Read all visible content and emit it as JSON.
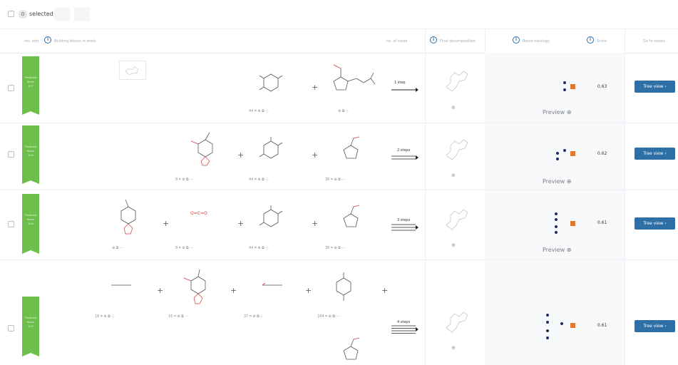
{
  "toolbar": {
    "selected_count": "0",
    "selected_label": "selected"
  },
  "columns": {
    "sort_label": "rec. sort",
    "building_blocks": "Building blocks in stock",
    "reactions": "no. of steps",
    "final_molecule": "Final decomposition",
    "route_topology": "Route topology",
    "score": "Score",
    "actions": "Go to routes"
  },
  "icons": {
    "info": "info-icon",
    "zoom": "magnifier-icon",
    "chevron": "chevron-right-icon"
  },
  "colors": {
    "ribbon": "#6cbf4b",
    "button": "#2e6fa6",
    "node": "#1f2f66",
    "target": "#e07a2e"
  },
  "routes": [
    {
      "ribbon_lines": [
        "Predicted",
        "Route",
        "#17"
      ],
      "steps_label": "1 step",
      "score": "0.63",
      "preview_label": "Preview",
      "tree_label": "Tree view",
      "tools": [
        "44 ⌗ ⊕ ⧉ ···",
        "⊕ ⧉ ···"
      ]
    },
    {
      "ribbon_lines": [
        "Predicted",
        "Route",
        "#18"
      ],
      "steps_label": "2 steps",
      "score": "0.62",
      "preview_label": "Preview",
      "tree_label": "Tree view",
      "tools": [
        "8 ⌗ ⊕ ⧉ ···",
        "44 ⌗ ⊕ ⧉ ···",
        "36 ⌗ ⊕ ⧉ ···"
      ]
    },
    {
      "ribbon_lines": [
        "Predicted",
        "Route",
        "#28"
      ],
      "steps_label": "3 steps",
      "score": "0.61",
      "preview_label": "Preview",
      "tree_label": "Tree view",
      "tools": [
        "⊕ ⧉ ···",
        "8 ⌗ ⊕ ⧉ ···",
        "44 ⌗ ⊕ ⧉ ···",
        "36 ⌗ ⊕ ⧉ ···"
      ],
      "co2": "O=C=O"
    },
    {
      "ribbon_lines": [
        "Predicted",
        "Route",
        "#35"
      ],
      "steps_label": "4 steps",
      "score": "0.61",
      "tree_label": "Tree view",
      "tools": [
        "16 ⌗ ⊕ ⧉ ···",
        "16 ⌗ ⊕ ⧉ ···",
        "37 ⌗ ⊕ ⧉ ···",
        "164 ⌗ ⊕ ⧉ ···"
      ]
    }
  ]
}
